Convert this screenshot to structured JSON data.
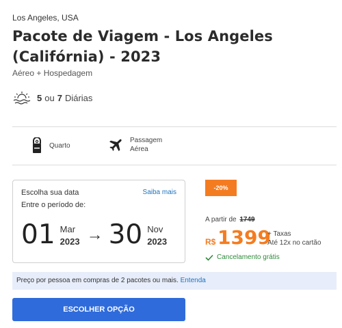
{
  "header": {
    "location": "Los Angeles, USA",
    "title": "Pacote de Viagem - Los Angeles (Califórnia) - 2023",
    "subtitle": "Aéreo + Hospedagem"
  },
  "nights": {
    "icon": "sunset-icon",
    "min": "5",
    "separator": "ou",
    "max": "7",
    "label": "Diárias"
  },
  "features": [
    {
      "icon": "door-hanger-icon",
      "label": "Quarto"
    },
    {
      "icon": "airplane-icon",
      "label_line1": "Passagem",
      "label_line2": "Aérea"
    }
  ],
  "date_selector": {
    "title": "Escolha sua data",
    "help_link": "Saiba mais",
    "period_label": "Entre o período de:",
    "start": {
      "day": "01",
      "month": "Mar",
      "year": "2023"
    },
    "arrow": "→",
    "end": {
      "day": "30",
      "month": "Nov",
      "year": "2023"
    }
  },
  "pricing": {
    "discount_badge": "-20%",
    "from_label": "A partir de",
    "old_price": "1749",
    "currency": "R$",
    "price": "1399",
    "taxes": "+ Taxas",
    "installments": "Até 12x no cartão",
    "cancellation": "Cancelamento grátis"
  },
  "info": {
    "text": "Preço por pessoa em compras de 2 pacotes ou mais.",
    "link": "Entenda"
  },
  "cta": {
    "label": "ESCOLHER OPÇÃO"
  },
  "colors": {
    "accent_orange": "#f47c20",
    "button_blue": "#2f6bdb",
    "link_blue": "#1e73be",
    "success_green": "#2e8b3a",
    "info_bg": "#e7edfa"
  }
}
